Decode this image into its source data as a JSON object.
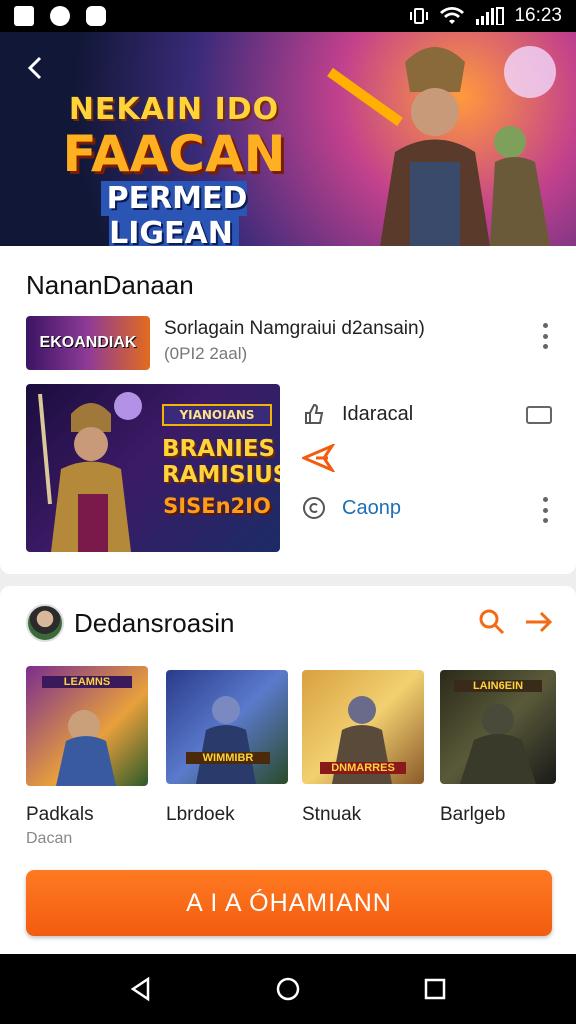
{
  "status_bar": {
    "time": "16:23",
    "bg": "#000000"
  },
  "hero": {
    "title_line1": "NEKAIN IDO",
    "title_line2": "FAACAN",
    "title_line3": "PERMED LIGEAN"
  },
  "featured": {
    "title": "NananDanaan",
    "row": {
      "thumb_label": "EKOANDIAK",
      "title": "Sorlagain Namgraiui d2ansain)",
      "subtitle": "(0PI2 2aal)"
    },
    "image_text": {
      "line1": "YIANOIANS",
      "line2": "BRANIES RAMISIUS",
      "line3": "SISEn2IO"
    },
    "actions": {
      "first": "Idaracal",
      "third": "Caonp"
    }
  },
  "section": {
    "title": "Dedansroasin",
    "games": [
      {
        "title": "Padkals",
        "subtitle": "Dacan",
        "banner": "LEAMNS"
      },
      {
        "title": "Lbrdoek",
        "subtitle": "",
        "banner": "WIMMIBR"
      },
      {
        "title": "Stnuak",
        "subtitle": "",
        "banner": "DNMARRES"
      },
      {
        "title": "Barlgeb",
        "subtitle": "",
        "banner": "LAIN6EIN"
      }
    ]
  },
  "cta": {
    "label": "A I A ÓHAMIANN"
  },
  "colors": {
    "accent": "#f26a16",
    "link": "#1e6fb6"
  },
  "icons": {
    "back": "back-arrow-icon",
    "search": "search-icon",
    "arrow": "arrow-right-icon",
    "nav": [
      "back-triangle-icon",
      "home-circle-icon",
      "recents-square-icon"
    ]
  }
}
